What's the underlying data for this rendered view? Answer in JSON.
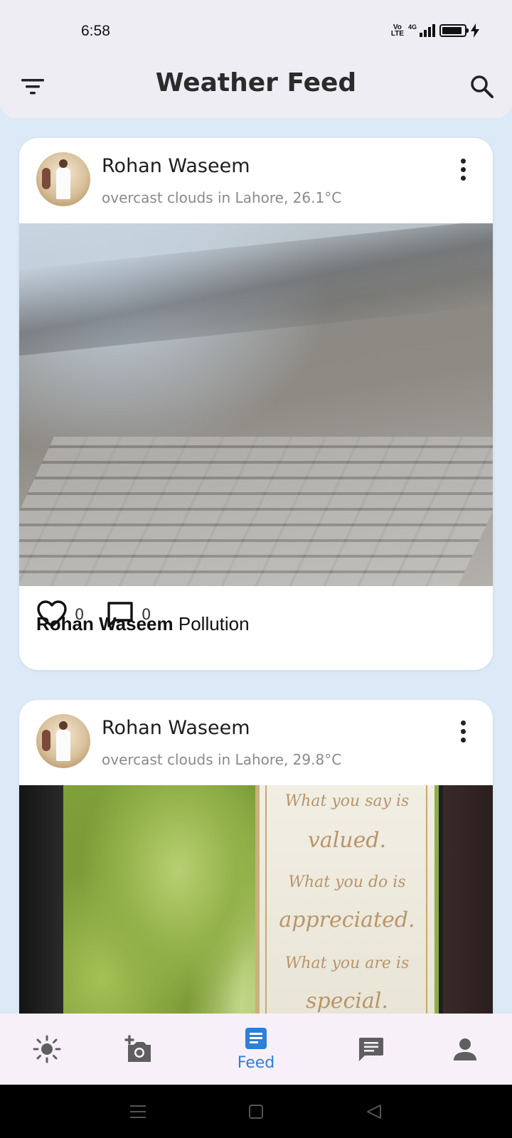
{
  "status_bar": {
    "time": "6:58",
    "network_label": "4G",
    "volte_label": "Vo LTE",
    "battery_level": 0.9
  },
  "app_bar": {
    "title": "Weather Feed",
    "filter_icon": "filter-list-icon",
    "search_icon": "search-icon"
  },
  "posts": [
    {
      "username": "Rohan Waseem",
      "weather_text": "overcast clouds in Lahore, 26.1°C",
      "likes": "0",
      "comments": "0",
      "caption_user": "Rohan Waseem",
      "caption_text": " Pollution"
    },
    {
      "username": "Rohan Waseem",
      "weather_text": "overcast clouds in Lahore, 29.8°C",
      "photo_text": [
        "What you say is",
        "valued.",
        "What you do is",
        "appreciated.",
        "What you are is",
        "special."
      ]
    }
  ],
  "bottom_nav": {
    "items": [
      {
        "icon": "sun-icon"
      },
      {
        "icon": "add-photo-icon"
      },
      {
        "icon": "feed-icon",
        "label": "Feed",
        "active": true
      },
      {
        "icon": "chat-icon"
      },
      {
        "icon": "person-icon"
      }
    ],
    "active_color": "#2e7fd6",
    "inactive_color": "#5f5f5f"
  }
}
